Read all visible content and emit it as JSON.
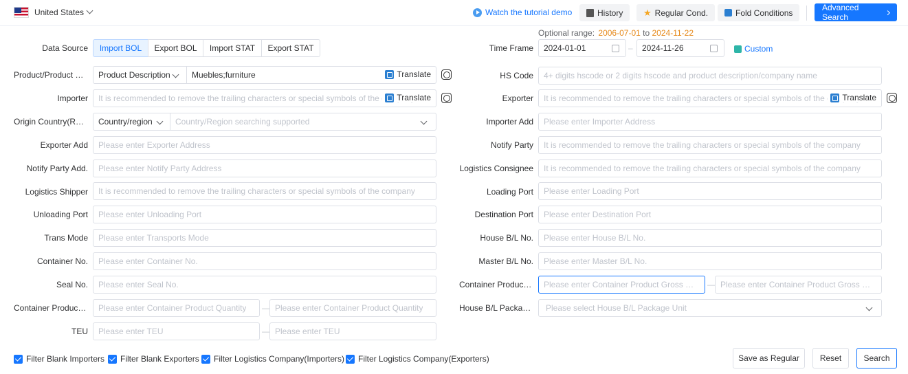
{
  "header": {
    "country": "United States",
    "tutorial": "Watch the tutorial demo",
    "history": "History",
    "regular": "Regular Cond.",
    "fold": "Fold Conditions",
    "advanced": "Advanced Search"
  },
  "range": {
    "label": "Optional range:",
    "start": "2006-07-01",
    "to": "to",
    "end": "2024-11-22"
  },
  "data_source": {
    "label": "Data Source",
    "options": [
      "Import BOL",
      "Export BOL",
      "Import STAT",
      "Export STAT"
    ],
    "active": "Import BOL"
  },
  "time_frame": {
    "label": "Time Frame",
    "from": "2024-01-01",
    "to": "2024-11-26",
    "dash": "–",
    "custom": "Custom"
  },
  "product": {
    "label": "Product/Product De...",
    "select": "Product Description",
    "value": "Muebles;furniture",
    "translate": "Translate"
  },
  "hs_code": {
    "label": "HS Code",
    "placeholder": "4+ digits hscode or 2 digits hscode and product description/company name"
  },
  "importer": {
    "label": "Importer",
    "placeholder": "It is recommended to remove the trailing characters or special symbols of the company",
    "translate": "Translate"
  },
  "exporter": {
    "label": "Exporter",
    "placeholder": "It is recommended to remove the trailing characters or special symbols of the company",
    "translate": "Translate"
  },
  "origin": {
    "label": "Origin Country(Regi...",
    "select": "Country/region",
    "placeholder": "Country/Region searching supported"
  },
  "importer_add": {
    "label": "Importer Add",
    "placeholder": "Please enter Importer Address"
  },
  "exporter_add": {
    "label": "Exporter Add",
    "placeholder": "Please enter Exporter Address"
  },
  "notify_party": {
    "label": "Notify Party",
    "placeholder": "It is recommended to remove the trailing characters or special symbols of the company"
  },
  "notify_party_add": {
    "label": "Notify Party Add.",
    "placeholder": "Please enter Notify Party Address"
  },
  "logistics_consignee": {
    "label": "Logistics Consignee",
    "placeholder": "It is recommended to remove the trailing characters or special symbols of the company"
  },
  "logistics_shipper": {
    "label": "Logistics Shipper",
    "placeholder": "It is recommended to remove the trailing characters or special symbols of the company"
  },
  "loading_port": {
    "label": "Loading Port",
    "placeholder": "Please enter Loading Port"
  },
  "unloading_port": {
    "label": "Unloading Port",
    "placeholder": "Please enter Unloading Port"
  },
  "destination_port": {
    "label": "Destination Port",
    "placeholder": "Please enter Destination Port"
  },
  "trans_mode": {
    "label": "Trans Mode",
    "placeholder": "Please enter Transports Mode"
  },
  "house_bl": {
    "label": "House B/L No.",
    "placeholder": "Please enter House B/L No."
  },
  "container_no": {
    "label": "Container No.",
    "placeholder": "Please enter Container No."
  },
  "master_bl": {
    "label": "Master B/L No.",
    "placeholder": "Please enter Master B/L No."
  },
  "seal_no": {
    "label": "Seal No.",
    "placeholder": "Please enter Seal No."
  },
  "gross_weight": {
    "label": "Container Product ...",
    "placeholder": "Please enter Container Product Gross Weigh..."
  },
  "quantity": {
    "label": "Container Product ...",
    "placeholder": "Please enter Container Product Quantity"
  },
  "package_unit": {
    "label": "House B/L Packag...",
    "placeholder": "Please select House B/L Package Unit"
  },
  "teu": {
    "label": "TEU",
    "placeholder": "Please enter TEU"
  },
  "filters": [
    "Filter Blank Importers",
    "Filter Blank Exporters",
    "Filter Logistics Company(Importers)",
    "Filter Logistics Company(Exporters)"
  ],
  "actions": {
    "save": "Save as Regular",
    "reset": "Reset",
    "search": "Search"
  },
  "colors": {
    "primary": "#1677ff",
    "range_date": "#e6891a"
  }
}
